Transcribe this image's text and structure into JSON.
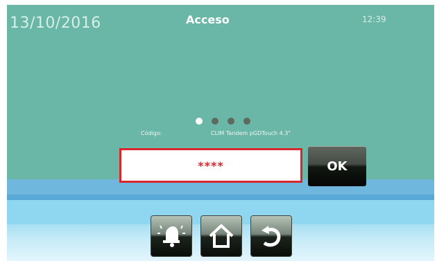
{
  "header": {
    "date": "13/10/2016",
    "title": "Acceso",
    "time": "12:39"
  },
  "login": {
    "code_label": "Código:",
    "device_label": "CLIM Tandem pGDTouch 4.3\"",
    "password_mask": "****",
    "ok_label": "OK"
  },
  "pager": {
    "total": 4,
    "active_index": 0
  },
  "navigation": {
    "buttons": [
      "alarm-bell-icon",
      "home-icon",
      "back-icon"
    ]
  },
  "colors": {
    "background": "#6ab6a7",
    "password_border": "#d8262c",
    "password_text": "#d8262c"
  }
}
